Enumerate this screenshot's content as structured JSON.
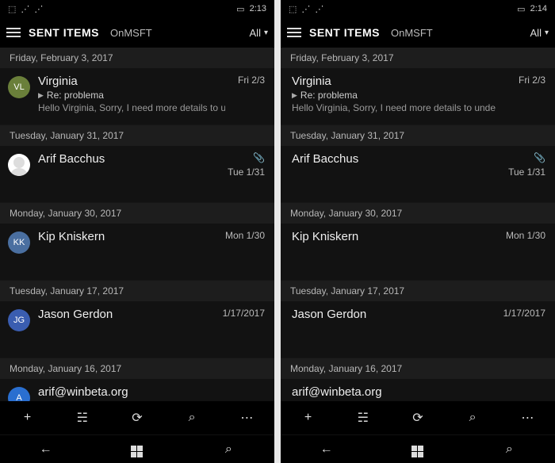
{
  "panes": [
    {
      "status_time": "2:13",
      "show_avatars": true,
      "header": {
        "folder": "SENT ITEMS",
        "account": "OnMSFT",
        "filter": "All"
      },
      "groups": [
        {
          "date": "Friday, February 3, 2017",
          "items": [
            {
              "sender": "Virginia",
              "avatar_initials": "VL",
              "avatar_bg": "#6a7f3a",
              "subject": "Re: problema",
              "reply": true,
              "preview": "Hello Virginia, Sorry, I need more details to u",
              "date": "Fri 2/3",
              "attachment": false,
              "tall": true
            }
          ]
        },
        {
          "date": "Tuesday, January 31, 2017",
          "items": [
            {
              "sender": "Arif Bacchus",
              "avatar_initials": "",
              "avatar_bg": "#ffffff",
              "avatar_img": true,
              "subject": "",
              "reply": false,
              "preview": "",
              "date": "Tue 1/31",
              "attachment": true,
              "tall": true
            }
          ]
        },
        {
          "date": "Monday, January 30, 2017",
          "items": [
            {
              "sender": "Kip Kniskern",
              "avatar_initials": "KK",
              "avatar_bg": "#4a6fa0",
              "subject": "",
              "reply": false,
              "preview": "",
              "date": "Mon 1/30",
              "attachment": false,
              "tall": true
            }
          ]
        },
        {
          "date": "Tuesday, January 17, 2017",
          "items": [
            {
              "sender": "Jason Gerdon",
              "avatar_initials": "JG",
              "avatar_bg": "#3a5db0",
              "subject": "",
              "reply": false,
              "preview": "",
              "date": "1/17/2017",
              "attachment": false,
              "tall": true
            }
          ]
        },
        {
          "date": "Monday, January 16, 2017",
          "items": [
            {
              "sender": "arif@winbeta.org",
              "avatar_initials": "A",
              "avatar_bg": "#2a6fd0",
              "subject": "",
              "reply": false,
              "preview": "",
              "date": "",
              "attachment": false,
              "tall": false
            }
          ]
        }
      ]
    },
    {
      "status_time": "2:14",
      "show_avatars": false,
      "header": {
        "folder": "SENT ITEMS",
        "account": "OnMSFT",
        "filter": "All"
      },
      "groups": [
        {
          "date": "Friday, February 3, 2017",
          "items": [
            {
              "sender": "Virginia",
              "subject": "Re: problema",
              "reply": true,
              "preview": "Hello Virginia, Sorry, I need more details to unde",
              "date": "Fri 2/3",
              "attachment": false,
              "tall": true
            }
          ]
        },
        {
          "date": "Tuesday, January 31, 2017",
          "items": [
            {
              "sender": "Arif Bacchus",
              "subject": "",
              "reply": false,
              "preview": "",
              "date": "Tue 1/31",
              "attachment": true,
              "tall": true
            }
          ]
        },
        {
          "date": "Monday, January 30, 2017",
          "items": [
            {
              "sender": "Kip Kniskern",
              "subject": "",
              "reply": false,
              "preview": "",
              "date": "Mon 1/30",
              "attachment": false,
              "tall": true
            }
          ]
        },
        {
          "date": "Tuesday, January 17, 2017",
          "items": [
            {
              "sender": "Jason Gerdon",
              "subject": "",
              "reply": false,
              "preview": "",
              "date": "1/17/2017",
              "attachment": false,
              "tall": true
            }
          ]
        },
        {
          "date": "Monday, January 16, 2017",
          "items": [
            {
              "sender": "arif@winbeta.org",
              "subject": "",
              "reply": false,
              "preview": "",
              "date": "",
              "attachment": false,
              "tall": false
            }
          ]
        }
      ]
    }
  ],
  "appbar": {
    "new": "+",
    "select": "☵",
    "sync": "⟳",
    "search": "⌕",
    "more": "⋯"
  },
  "nav": {
    "back": "←",
    "search": "⌕"
  }
}
